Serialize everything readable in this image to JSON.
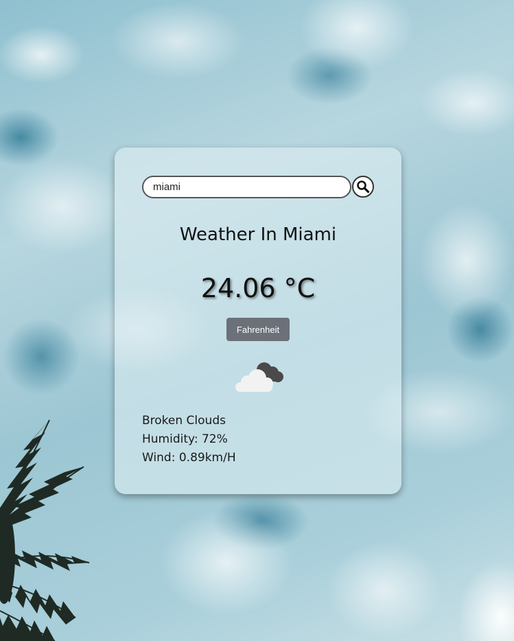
{
  "search": {
    "value": "miami",
    "placeholder": ""
  },
  "search_button": {
    "icon": "search-icon"
  },
  "weather": {
    "title": "Weather In Miami",
    "temperature": "24.06 °C",
    "unit_toggle_label": "Fahrenheit",
    "condition_icon": "broken-clouds-icon",
    "description": "Broken Clouds",
    "humidity": "Humidity: 72%",
    "wind": "Wind: 0.89km/H"
  },
  "colors": {
    "button_bg": "#6b7079",
    "card_bg": "rgba(225,240,244,0.55)"
  }
}
